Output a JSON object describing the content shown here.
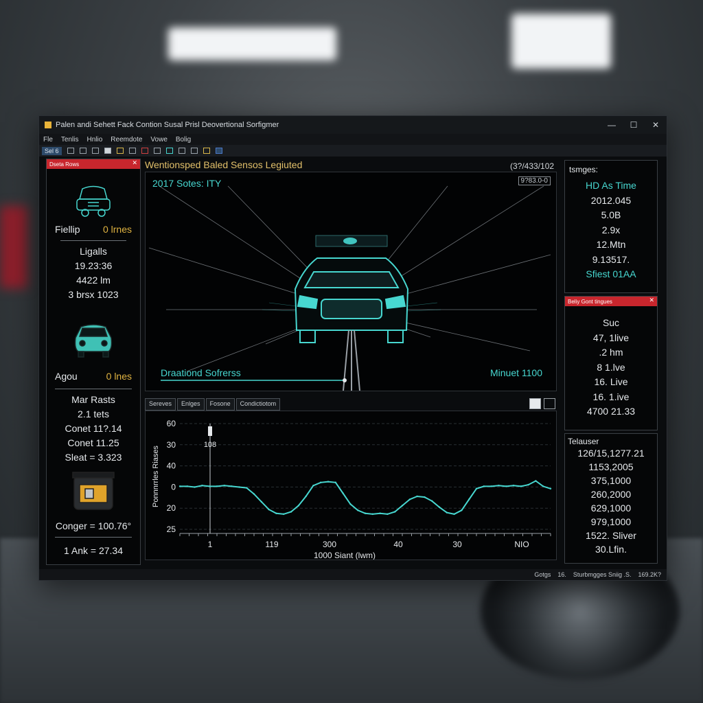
{
  "window": {
    "title": "Palen andi Sehett Fack Contion Susal Prisl Deovertional Sorfigmer",
    "controls": {
      "minimize": "—",
      "maximize": "☐",
      "close": "✕"
    }
  },
  "menu": {
    "items": [
      "Fle",
      "Tenlis",
      "Hnlio",
      "Reemdote",
      "Vowe",
      "Bolig"
    ]
  },
  "toolbar": {
    "label": "Sel 6"
  },
  "left_panel": {
    "header": "Dseta Rows",
    "car1": {
      "name": "Fiellip",
      "value": "0 lrnes"
    },
    "lists": {
      "title": "Ligalls",
      "lines": [
        "19.23:36",
        "4422 lm",
        "3 brsx 1023"
      ]
    },
    "car2": {
      "name": "Agou",
      "value": "0 lnes"
    },
    "mar": {
      "title": "Mar Rasts",
      "lines": [
        "2.1 tets",
        "Conet 11?.14",
        "Conet 11.25",
        "Sleat = 3.323"
      ]
    },
    "conger": "Conger = 100.76°",
    "ank": "1 Ank = 27.34"
  },
  "center": {
    "title": "Wentionsped Baled Sensos Legiuted",
    "code": "(3?/433/102",
    "view": {
      "top_label": "2017 Sotes: ITY",
      "top_right_box": "9?83.0-0",
      "bottom_left": "Draationd Sofrerss",
      "bottom_right": "Minuet 1100"
    }
  },
  "tabs": [
    "Sereves",
    "Enlges",
    "Fosone",
    "Condictiotom"
  ],
  "chart_data": {
    "type": "line",
    "ylabel": "Ponnnrrles Riases",
    "xlabel": "1000 Siant (lwm)",
    "y_ticks": [
      "60",
      "30",
      "40",
      "0",
      "20",
      "25"
    ],
    "x_ticks": [
      "1",
      "119",
      "300",
      "40",
      "30",
      "NIO"
    ],
    "marker_label": "108",
    "series": [
      {
        "color": "#47d7d0",
        "values": [
          5,
          5,
          4,
          6,
          5,
          5,
          6,
          5,
          4,
          3,
          -5,
          -15,
          -25,
          -30,
          -31,
          -28,
          -20,
          -8,
          6,
          10,
          11,
          10,
          -4,
          -18,
          -26,
          -30,
          -31,
          -30,
          -31,
          -28,
          -20,
          -12,
          -8,
          -9,
          -14,
          -22,
          -29,
          -31,
          -26,
          -12,
          2,
          5,
          5,
          6,
          5,
          6,
          5,
          7,
          12,
          5,
          2
        ]
      }
    ]
  },
  "right_top": {
    "title": "tsmges:",
    "hd": "HD As Time",
    "lines": [
      "2012.045",
      "5.0B",
      "2.9x",
      "12.Mtn",
      "9.13517."
    ],
    "footer": "Sfiest 01AA"
  },
  "right_mid": {
    "header": "Beliy Gont tingues",
    "lines": [
      "Suc",
      "47, 1live",
      ".2 hm",
      "8 1.lve",
      "16. Live",
      "16. 1.ive",
      "4700 21.33"
    ]
  },
  "right_bottom": {
    "title": "Telauser",
    "lines": [
      "126/15,1277.21",
      "1153,2005",
      "375,1000",
      "260,2000",
      "629,1000",
      "979,1000",
      "1522. Sliver",
      "30.Lfin."
    ]
  },
  "statusbar": [
    "Gotgs",
    "16.",
    "Sturbmgges Sniig .S.",
    "169.2K?"
  ]
}
